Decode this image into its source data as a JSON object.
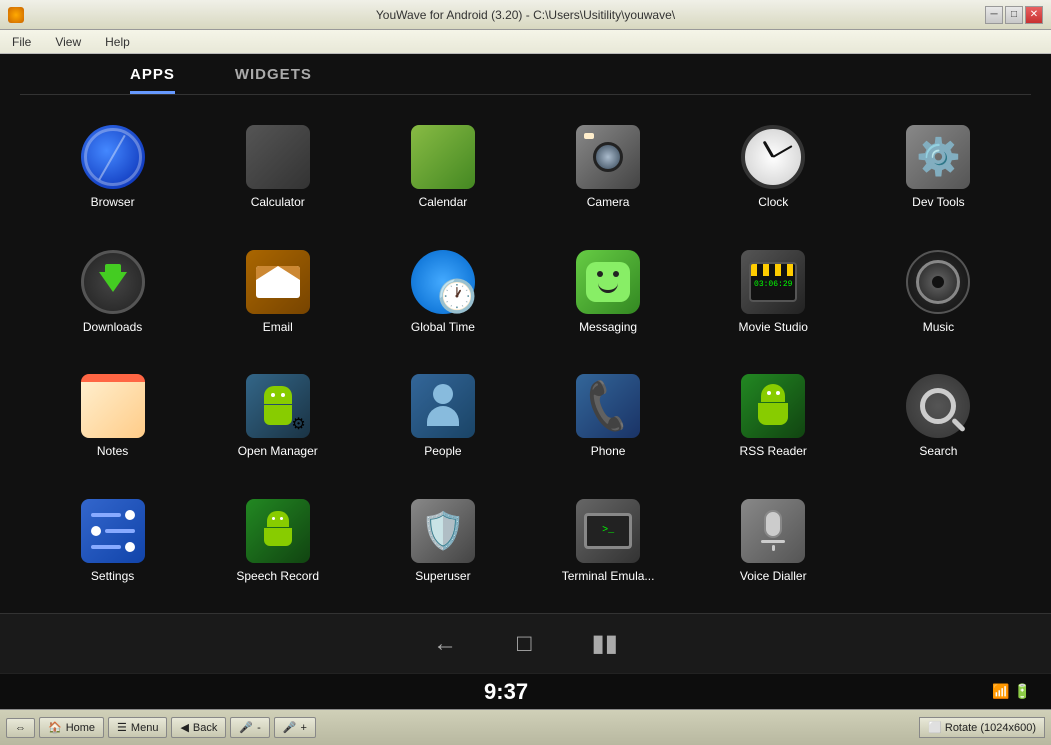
{
  "window": {
    "title": "YouWave for Android (3.20) - C:\\Users\\Usitility\\youwave\\",
    "menu": {
      "items": [
        "File",
        "View",
        "Help"
      ]
    }
  },
  "tabs": {
    "items": [
      "APPS",
      "WIDGETS"
    ],
    "active": "APPS"
  },
  "apps": [
    {
      "id": "browser",
      "label": "Browser"
    },
    {
      "id": "calculator",
      "label": "Calculator"
    },
    {
      "id": "calendar",
      "label": "Calendar"
    },
    {
      "id": "camera",
      "label": "Camera"
    },
    {
      "id": "clock",
      "label": "Clock"
    },
    {
      "id": "devtools",
      "label": "Dev Tools"
    },
    {
      "id": "downloads",
      "label": "Downloads"
    },
    {
      "id": "email",
      "label": "Email"
    },
    {
      "id": "globaltime",
      "label": "Global Time"
    },
    {
      "id": "messaging",
      "label": "Messaging"
    },
    {
      "id": "moviestyle",
      "label": "Movie Studio"
    },
    {
      "id": "music",
      "label": "Music"
    },
    {
      "id": "notes",
      "label": "Notes"
    },
    {
      "id": "openmanager",
      "label": "Open Manager"
    },
    {
      "id": "people",
      "label": "People"
    },
    {
      "id": "phone",
      "label": "Phone"
    },
    {
      "id": "rss",
      "label": "RSS Reader"
    },
    {
      "id": "search",
      "label": "Search"
    },
    {
      "id": "settings",
      "label": "Settings"
    },
    {
      "id": "speechrecord",
      "label": "Speech Record"
    },
    {
      "id": "superuser",
      "label": "Superuser"
    },
    {
      "id": "terminal",
      "label": "Terminal Emula..."
    },
    {
      "id": "voicedialler",
      "label": "Voice Dialler"
    }
  ],
  "statusbar": {
    "time": "9:37"
  },
  "taskbar": {
    "home_label": "Home",
    "menu_label": "Menu",
    "back_label": "Back",
    "rotate_label": "Rotate (1024x600)"
  }
}
